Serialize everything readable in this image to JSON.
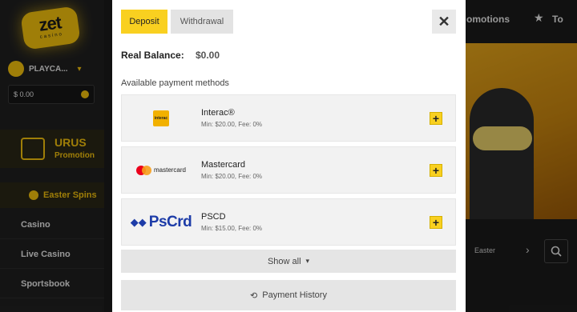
{
  "site": {
    "logo": "zet",
    "logo_sub": "casino",
    "user_name": "PLAYCA...",
    "balance": "$ 0.00",
    "promo_title": "URUS",
    "promo_sub": "Promotion",
    "easter_label": "Easter Spins",
    "nav": [
      "Casino",
      "Live Casino",
      "Sportsbook"
    ],
    "top_links": [
      "omotions",
      "To"
    ],
    "carousel_label": "Easter"
  },
  "modal": {
    "tabs": {
      "deposit": "Deposit",
      "withdrawal": "Withdrawal"
    },
    "real_balance_label": "Real Balance:",
    "real_balance_value": "$0.00",
    "available_label": "Available payment methods",
    "methods": [
      {
        "name": "Interac®",
        "info": "Min: $20.00, Fee: 0%",
        "logo": "interac"
      },
      {
        "name": "Mastercard",
        "info": "Min: $20.00, Fee: 0%",
        "logo": "mastercard"
      },
      {
        "name": "PSCD",
        "info": "Min: $15.00, Fee: 0%",
        "logo": "PsCrd"
      }
    ],
    "show_all": "Show all",
    "payment_history": "Payment History"
  },
  "colors": {
    "accent": "#f9d020",
    "brand_yellow": "#f4c20d",
    "pscrd_blue": "#1d3ca8"
  },
  "icons": [
    "close-icon",
    "plus-icon",
    "chevron-down-icon",
    "history-icon",
    "search-icon",
    "star-icon",
    "chevron-right-icon"
  ]
}
